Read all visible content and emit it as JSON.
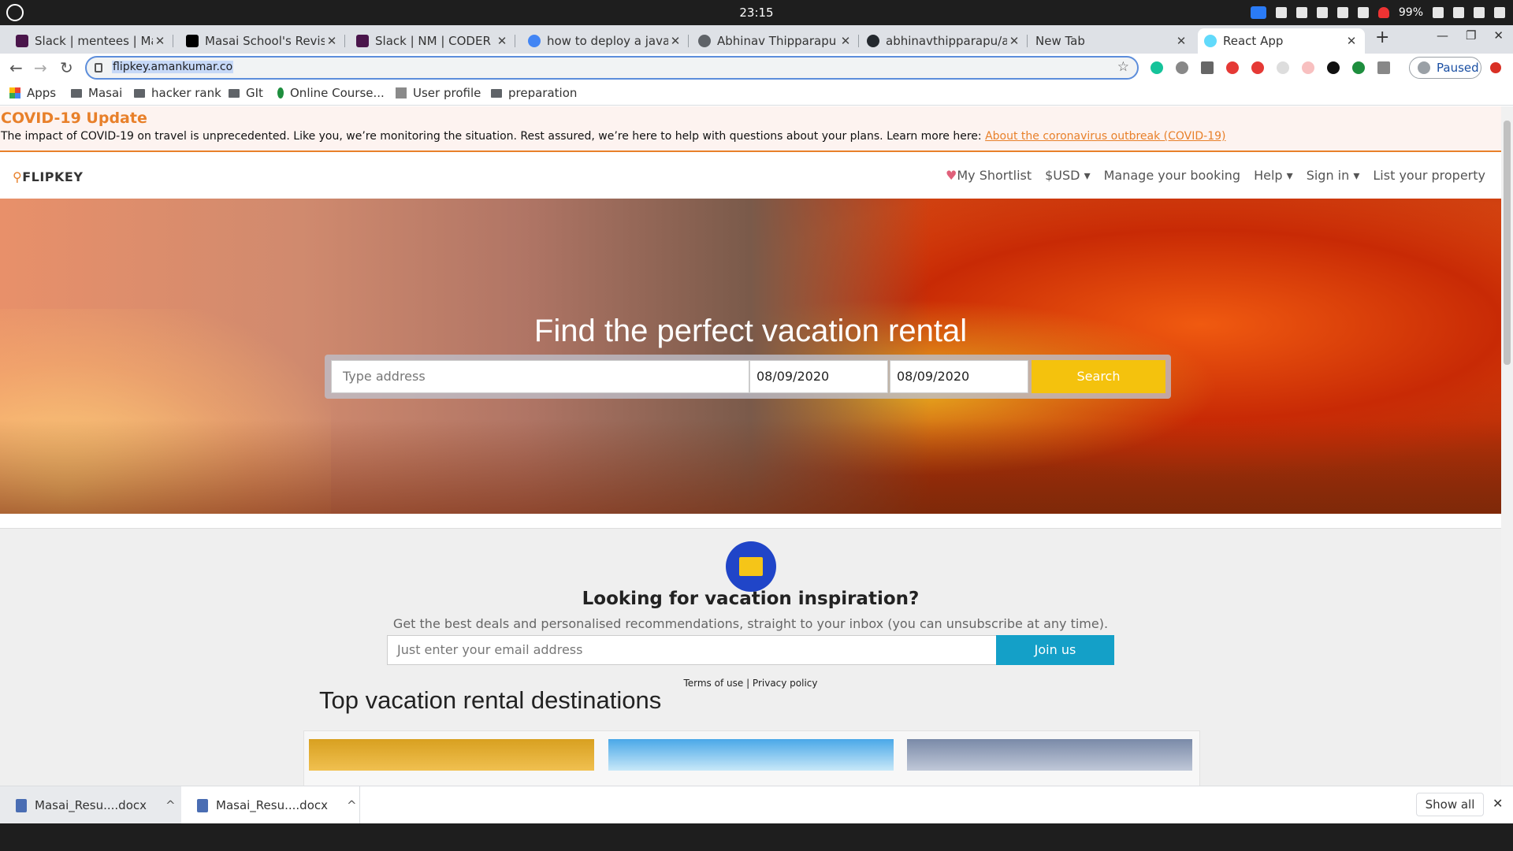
{
  "system": {
    "clock": "23:15",
    "battery": "99%"
  },
  "tabs": [
    {
      "title": "Slack | mentees | Masai",
      "icon": "slack-icon",
      "color": "#4a154b"
    },
    {
      "title": "Masai School's Revision",
      "icon": "notion-icon",
      "color": "#000000"
    },
    {
      "title": "Slack | NM | CODER Sp",
      "icon": "slack-icon",
      "color": "#4a154b"
    },
    {
      "title": "how to deploy a javasc",
      "icon": "google-icon",
      "color": "#4285f4"
    },
    {
      "title": "Abhinav Thipparapu",
      "icon": "globe-icon",
      "color": "#5f6368"
    },
    {
      "title": "abhinavthipparapu/ab",
      "icon": "github-icon",
      "color": "#24292e"
    },
    {
      "title": "New Tab",
      "icon": "",
      "color": ""
    },
    {
      "title": "React App",
      "icon": "react-icon",
      "color": "#61dafb"
    }
  ],
  "browser": {
    "url": "flipkey.amankumar.co",
    "profile": "Paused"
  },
  "bookmarks": [
    "Apps",
    "Masai",
    "hacker rank",
    "GIt",
    "Online Course...",
    "User profile",
    "preparation"
  ],
  "covid": {
    "title": "COVID-19 Update",
    "text": "The impact of COVID-19 on travel is unprecedented. Like you, we’re monitoring the situation. Rest assured, we’re here to help with questions about your plans. Learn more here: ",
    "link": "About the coronavirus outbreak (COVID-19)"
  },
  "site": {
    "logo": "FLIPKEY",
    "nav": {
      "shortlist": "My Shortlist",
      "currency": "$USD",
      "manage": "Manage your booking",
      "help": "Help",
      "signin": "Sign in",
      "list": "List your property"
    }
  },
  "hero": {
    "title": "Find the perfect vacation rental",
    "address_placeholder": "Type address",
    "checkin": "08/09/2020",
    "checkout": "08/09/2020",
    "search": "Search"
  },
  "newsletter": {
    "title": "Looking for vacation inspiration?",
    "subtitle": "Get the best deals and personalised recommendations, straight to your inbox (you can unsubscribe at any time).",
    "email_placeholder": "Just enter your email address",
    "join": "Join us",
    "terms": "Terms of use",
    "privacy": "Privacy policy"
  },
  "destinations": {
    "title": "Top vacation rental destinations"
  },
  "downloads": {
    "files": [
      "Masai_Resu....docx",
      "Masai_Resu....docx"
    ],
    "show_all": "Show all"
  },
  "colors": {
    "accent": "#e8802a",
    "search": "#f4c20d",
    "join": "#14a0c8",
    "mail_icon": "#2045c8"
  }
}
